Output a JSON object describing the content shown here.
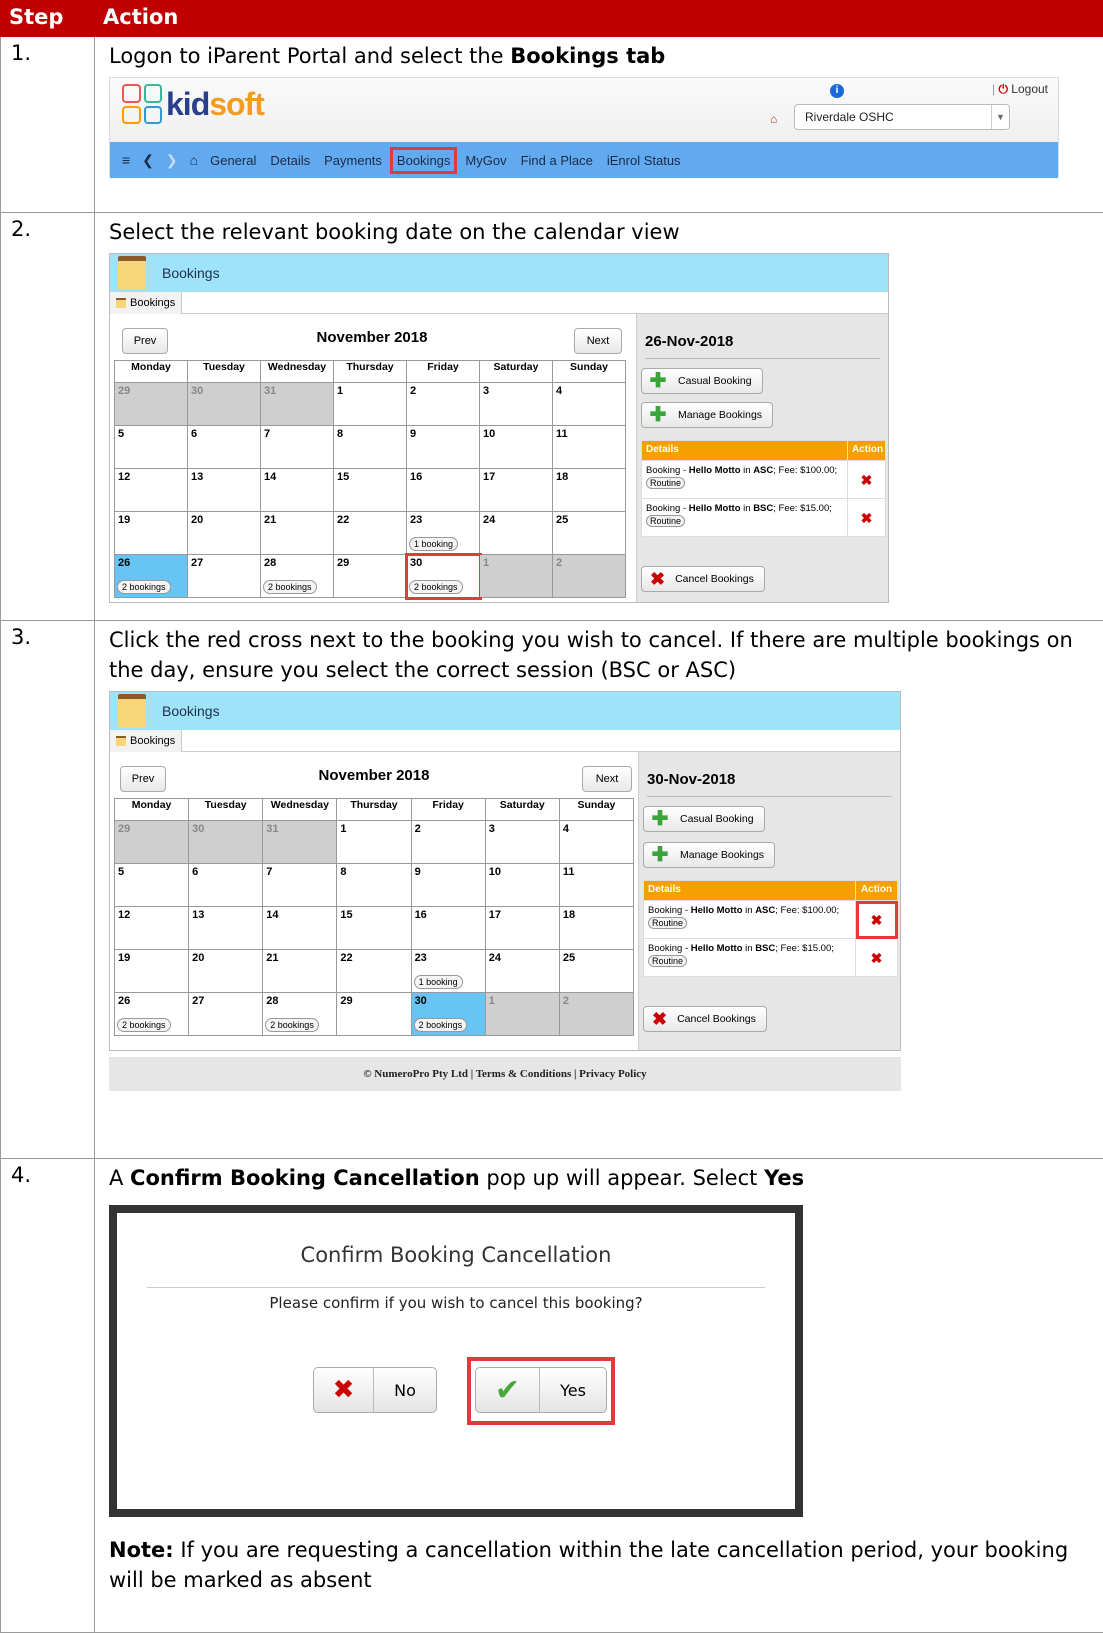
{
  "header": {
    "step": "Step",
    "action": "Action"
  },
  "steps": [
    {
      "num": "1.",
      "pre": "Logon to iParent Portal and select the ",
      "bold": "Bookings tab"
    },
    {
      "num": "2.",
      "text": "Select the relevant booking date on the calendar view"
    },
    {
      "num": "3.",
      "text": "Click the red cross next to the booking you wish to cancel. If there are multiple bookings on the day, ensure you select the correct session (BSC or ASC)"
    },
    {
      "num": "4.",
      "pre": "A ",
      "bold": "Confirm Booking Cancellation",
      "mid": " pop up will appear. Select ",
      "bold2": "Yes"
    }
  ],
  "portal": {
    "logo_k": "kid",
    "logo_s": "soft",
    "logout": "Logout",
    "school": "Riverdale OSHC",
    "nav": [
      "General",
      "Details",
      "Payments",
      "Bookings",
      "MyGov",
      "Find a Place",
      "iEnrol Status"
    ]
  },
  "bookings": {
    "title": "Bookings",
    "tab": "Bookings",
    "prev": "Prev",
    "next": "Next",
    "month": "November 2018",
    "days": [
      "Monday",
      "Tuesday",
      "Wednesday",
      "Thursday",
      "Friday",
      "Saturday",
      "Sunday"
    ],
    "weeks": [
      [
        "29",
        "30",
        "31",
        "1",
        "2",
        "3",
        "4"
      ],
      [
        "5",
        "6",
        "7",
        "8",
        "9",
        "10",
        "11"
      ],
      [
        "12",
        "13",
        "14",
        "15",
        "16",
        "17",
        "18"
      ],
      [
        "19",
        "20",
        "21",
        "22",
        "23",
        "24",
        "25"
      ],
      [
        "26",
        "27",
        "28",
        "29",
        "30",
        "1",
        "2"
      ]
    ],
    "pill_one": "1 booking",
    "pill_two": "2 bookings",
    "casual": "Casual Booking",
    "manage": "Manage Bookings",
    "details_hdr": "Details",
    "action_hdr": "Action",
    "row1_pre": "Booking - ",
    "row1_name": "Hello Motto",
    "row1_in": " in ",
    "row1_sess": "ASC",
    "row1_fee": "; Fee: $100.00; ",
    "row2_pre": "Booking - ",
    "row2_name": "Hello Motto",
    "row2_in": " in ",
    "row2_sess": "BSC",
    "row2_fee": "; Fee: $15.00; ",
    "routine": "Routine",
    "cancel": "Cancel Bookings",
    "date_a": "26-Nov-2018",
    "date_b": "30-Nov-2018"
  },
  "footer": {
    "text": "© NumeroPro Pty Ltd | Terms & Conditions | Privacy Policy"
  },
  "dialog": {
    "title": "Confirm Booking Cancellation",
    "message": "Please confirm if you wish to cancel this booking?",
    "no": "No",
    "yes": "Yes"
  },
  "note": {
    "label": "Note:",
    "text": " If you are requesting a cancellation within the late cancellation period, your booking will be marked as absent"
  },
  "colors": {
    "header_red": "#c00000",
    "nav_blue": "#62aaf0",
    "title_blue": "#9fe3f9",
    "details_orange": "#f5a000",
    "highlight": "#e03a3a"
  }
}
